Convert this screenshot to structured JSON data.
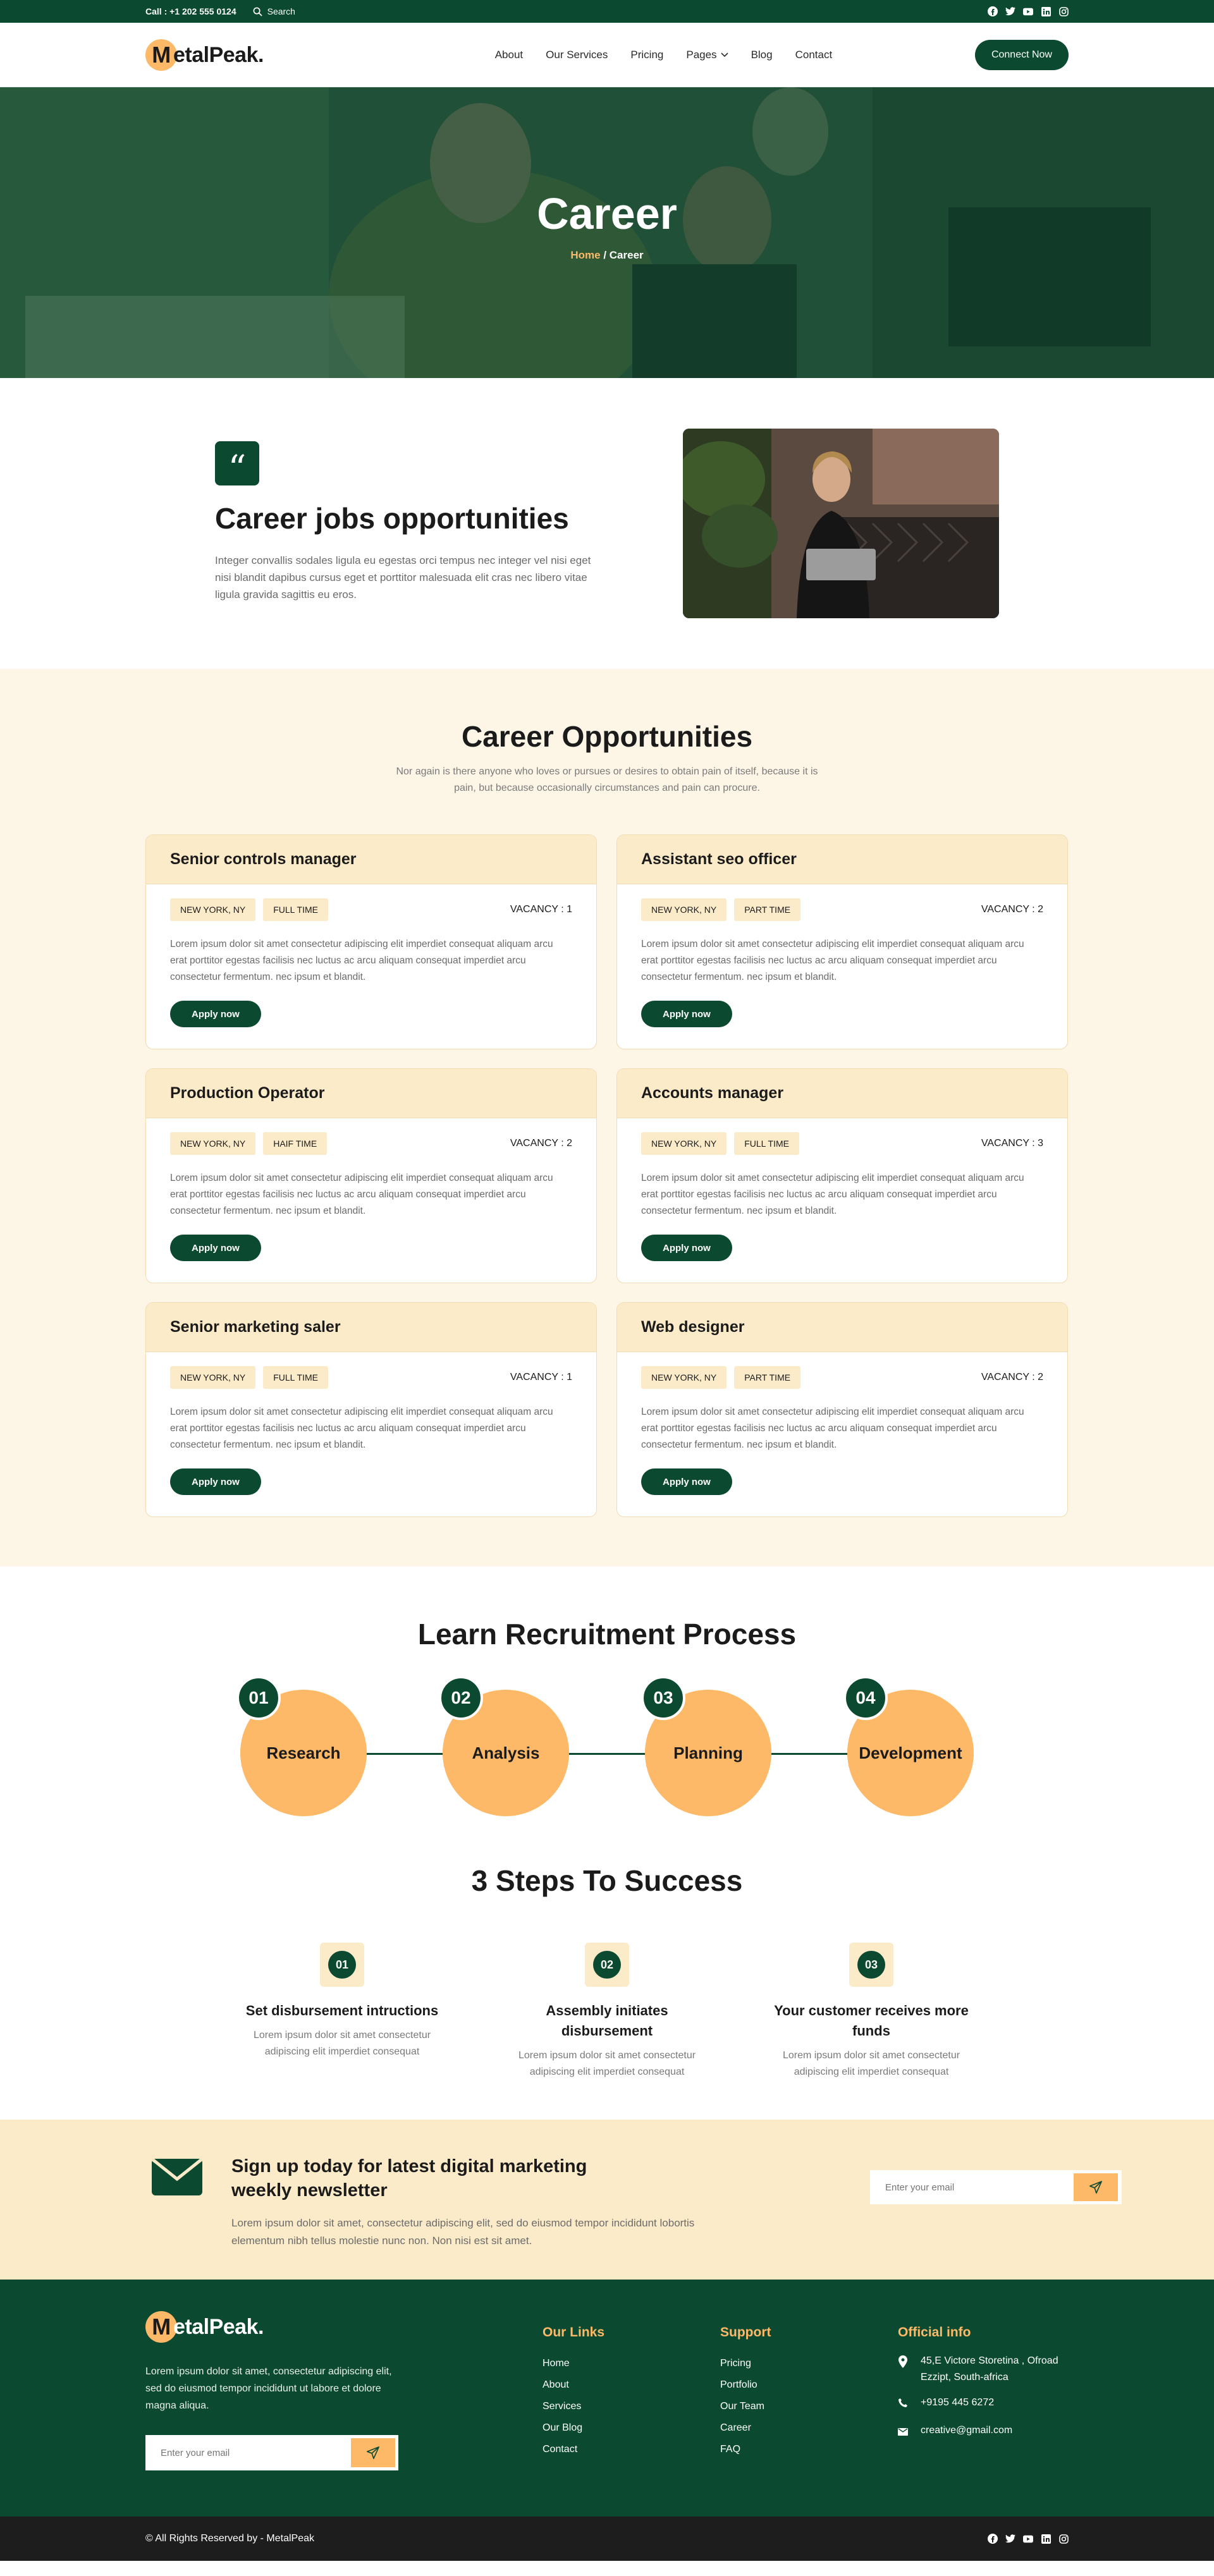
{
  "topbar": {
    "phone": "Call : +1 202 555 0124",
    "search_label": "Search",
    "social_icons": [
      "facebook-icon",
      "twitter-icon",
      "youtube-icon",
      "linkedin-icon",
      "instagram-icon"
    ]
  },
  "header": {
    "logo_letter": "M",
    "logo_rest": "etalPeak.",
    "nav": [
      {
        "label": "About"
      },
      {
        "label": "Our Services"
      },
      {
        "label": "Pricing"
      },
      {
        "label": "Pages"
      },
      {
        "label": "Blog"
      },
      {
        "label": "Contact"
      }
    ],
    "cta": "Connect Now"
  },
  "hero": {
    "title": "Career",
    "crumb_home": "Home",
    "crumb_sep": " / ",
    "crumb_current": "Career"
  },
  "intro": {
    "quote_mark": "“",
    "title": "Career jobs opportunities",
    "text": "Integer convallis sodales ligula eu egestas orci tempus nec integer vel nisi eget nisi blandit dapibus cursus eget et porttitor malesuada elit cras nec libero vitae ligula gravida sagittis eu eros."
  },
  "opportunities": {
    "title": "Career Opportunities",
    "subtitle": "Nor again is there anyone who loves or pursues or desires to obtain pain of itself, because it is pain, but because occasionally circumstances and pain can procure.",
    "jobs": [
      {
        "title": "Senior controls manager",
        "location": "NEW YORK, NY",
        "type": "FULL TIME",
        "vacancy": "VACANCY : 1",
        "desc": "Lorem ipsum dolor sit amet consectetur adipiscing elit imperdiet consequat aliquam arcu erat porttitor egestas facilisis nec luctus ac arcu aliquam consequat imperdiet arcu consectetur fermentum. nec ipsum et blandit.",
        "apply": "Apply now"
      },
      {
        "title": "Assistant seo officer",
        "location": "NEW YORK, NY",
        "type": "PART TIME",
        "vacancy": "VACANCY : 2",
        "desc": "Lorem ipsum dolor sit amet consectetur adipiscing elit imperdiet consequat aliquam arcu erat porttitor egestas facilisis nec luctus ac arcu aliquam consequat imperdiet arcu consectetur fermentum. nec ipsum et blandit.",
        "apply": "Apply now"
      },
      {
        "title": "Production Operator",
        "location": "NEW YORK, NY",
        "type": "HAIF TIME",
        "vacancy": "VACANCY : 2",
        "desc": "Lorem ipsum dolor sit amet consectetur adipiscing elit imperdiet consequat aliquam arcu erat porttitor egestas facilisis nec luctus ac arcu aliquam consequat imperdiet arcu consectetur fermentum. nec ipsum et blandit.",
        "apply": "Apply now"
      },
      {
        "title": "Accounts manager",
        "location": "NEW YORK, NY",
        "type": "FULL TIME",
        "vacancy": "VACANCY : 3",
        "desc": "Lorem ipsum dolor sit amet consectetur adipiscing elit imperdiet consequat aliquam arcu erat porttitor egestas facilisis nec luctus ac arcu aliquam consequat imperdiet arcu consectetur fermentum. nec ipsum et blandit.",
        "apply": "Apply now"
      },
      {
        "title": "Senior marketing saler",
        "location": "NEW YORK, NY",
        "type": "FULL TIME",
        "vacancy": "VACANCY : 1",
        "desc": "Lorem ipsum dolor sit amet consectetur adipiscing elit imperdiet consequat aliquam arcu erat porttitor egestas facilisis nec luctus ac arcu aliquam consequat imperdiet arcu consectetur fermentum. nec ipsum et blandit.",
        "apply": "Apply now"
      },
      {
        "title": "Web designer",
        "location": "NEW YORK, NY",
        "type": "PART TIME",
        "vacancy": "VACANCY : 2",
        "desc": "Lorem ipsum dolor sit amet consectetur adipiscing elit imperdiet consequat aliquam arcu erat porttitor egestas facilisis nec luctus ac arcu aliquam consequat imperdiet arcu consectetur fermentum. nec ipsum et blandit.",
        "apply": "Apply now"
      }
    ]
  },
  "process": {
    "title": "Learn Recruitment Process",
    "steps": [
      {
        "num": "01",
        "label": "Research"
      },
      {
        "num": "02",
        "label": "Analysis"
      },
      {
        "num": "03",
        "label": "Planning"
      },
      {
        "num": "04",
        "label": "Development"
      }
    ]
  },
  "success": {
    "title": "3 Steps To Success",
    "steps": [
      {
        "num": "01",
        "title": "Set disbursement intructions",
        "text": "Lorem ipsum dolor sit amet consectetur adipiscing elit imperdiet consequat"
      },
      {
        "num": "02",
        "title": "Assembly initiates disbursement",
        "text": "Lorem ipsum dolor sit amet consectetur adipiscing elit imperdiet consequat"
      },
      {
        "num": "03",
        "title": "Your customer receives more funds",
        "text": "Lorem ipsum dolor sit amet consectetur adipiscing elit imperdiet consequat"
      }
    ]
  },
  "newsletter": {
    "title": "Sign up today for latest digital marketing weekly newsletter",
    "text": "Lorem ipsum dolor sit amet, consectetur adipiscing elit, sed do eiusmod tempor incididunt lobortis elementum nibh tellus molestie nunc non. Non nisi est sit amet.",
    "placeholder": "Enter your email"
  },
  "footer": {
    "about": "Lorem ipsum dolor sit amet, consectetur adipiscing elit, sed do eiusmod tempor incididunt ut labore et dolore magna aliqua.",
    "placeholder": "Enter your email",
    "links_title": "Our Links",
    "links": [
      "Home",
      "About",
      "Services",
      "Our Blog",
      "Contact"
    ],
    "support_title": "Support",
    "support": [
      "Pricing",
      "Portfolio",
      "Our Team",
      "Career",
      "FAQ"
    ],
    "info_title": "Official info",
    "address": "45,E Victore Storetina , Ofroad Ezzipt, South-africa",
    "phone": "+9195 445 6272",
    "email": "creative@gmail.com",
    "copyright": "© All Rights Reserved by - MetalPeak"
  },
  "colors": {
    "brand": "#0b4a30",
    "accent": "#fdb868",
    "cream": "#fcebc9"
  }
}
